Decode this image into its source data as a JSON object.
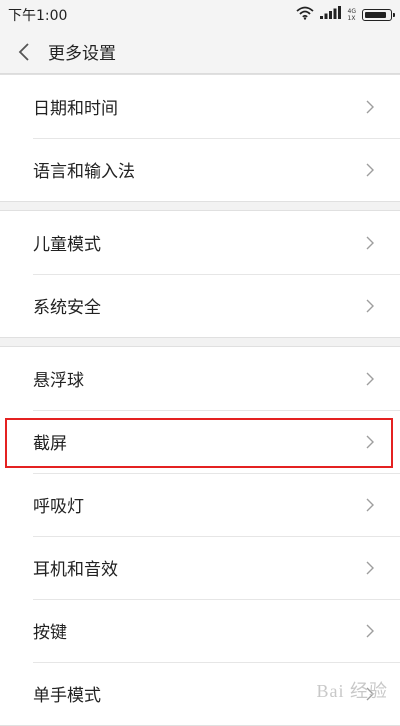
{
  "status": {
    "time": "下午1:00",
    "signal_top": "4G",
    "signal_bottom": "1X"
  },
  "header": {
    "title": "更多设置"
  },
  "groups": [
    {
      "items": [
        {
          "label": "日期和时间"
        },
        {
          "label": "语言和输入法"
        }
      ]
    },
    {
      "items": [
        {
          "label": "儿童模式"
        },
        {
          "label": "系统安全"
        }
      ]
    },
    {
      "items": [
        {
          "label": "悬浮球"
        },
        {
          "label": "截屏"
        },
        {
          "label": "呼吸灯"
        },
        {
          "label": "耳机和音效"
        },
        {
          "label": "按键"
        },
        {
          "label": "单手模式"
        }
      ]
    }
  ],
  "watermark": "Bai 经验",
  "colors": {
    "highlight": "#e42121",
    "background": "#f2f2f2"
  },
  "battery_level": 0.9
}
